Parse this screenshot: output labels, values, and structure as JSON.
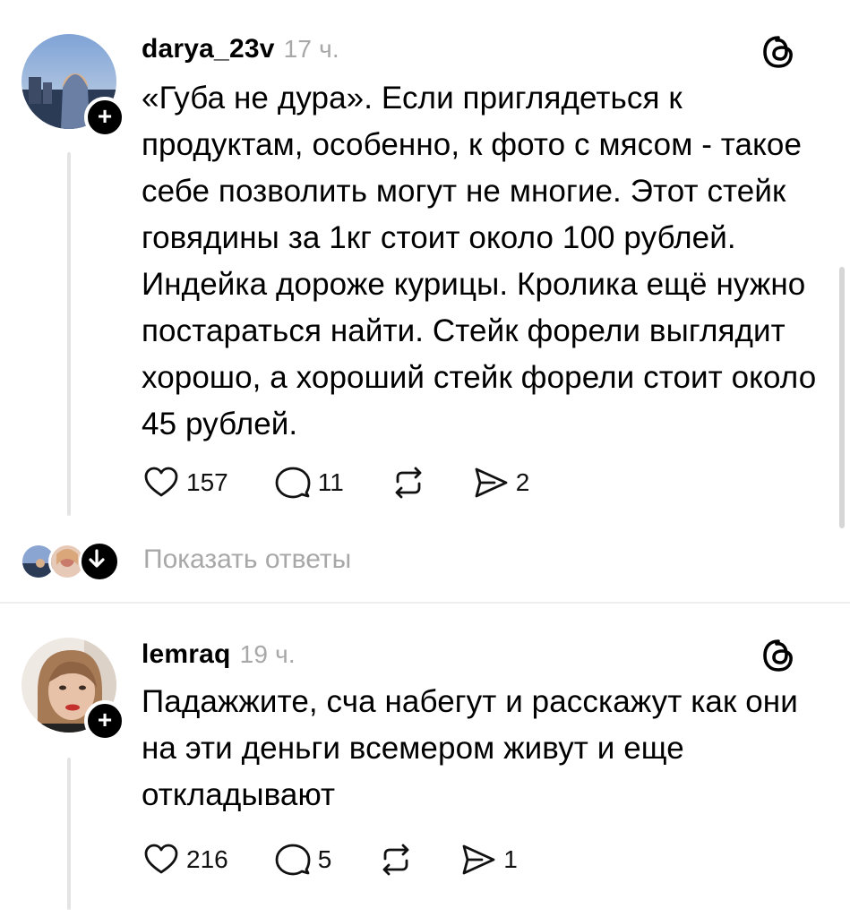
{
  "posts": [
    {
      "username": "darya_23v",
      "time": "17 ч.",
      "text": "«Губа не дура». Если приглядеться к продуктам, особенно, к фото с мясом - такое себе позволить могут не многие. Этот стейк говядины за 1кг стоит около 100 рублей. Индейка дороже курицы. Кролика ещё нужно постараться найти. Стейк форели выглядит хорошо, а хороший стейк форели стоит около 45 рублей.",
      "likes": "157",
      "comments": "11",
      "shares": "2"
    },
    {
      "username": "lemraq",
      "time": "19 ч.",
      "text": "Падажжите, сча набегут и расскажут как они на эти деньги всемером живут и еще откладывают",
      "likes": "216",
      "comments": "5",
      "shares": "1"
    }
  ],
  "show_replies_label": "Показать ответы",
  "follow_symbol": "+",
  "colors": {
    "muted": "#a8a8a8",
    "line": "#e4e4e4",
    "text": "#000000"
  }
}
